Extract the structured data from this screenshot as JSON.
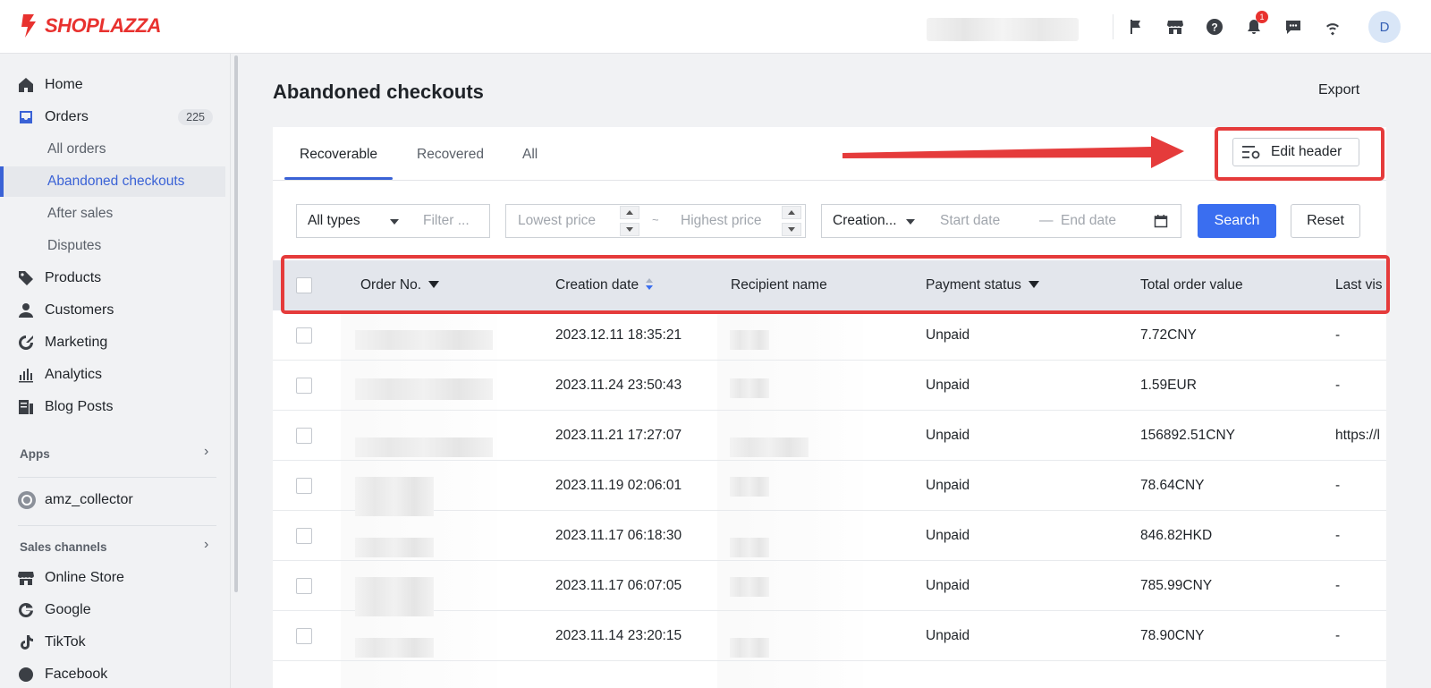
{
  "brand": {
    "name": "SHOPLAZZA",
    "color": "#e8322f",
    "accent": "#3a62d6"
  },
  "topbar": {
    "icons": [
      "flag-icon",
      "store-icon",
      "help-icon",
      "bell-icon",
      "chat-icon",
      "wifi-icon"
    ],
    "notification_count": "1",
    "avatar_initial": "D"
  },
  "sidebar": {
    "items": [
      {
        "label": "Home",
        "icon": "home-icon"
      },
      {
        "label": "Orders",
        "icon": "orders-icon",
        "badge": "225"
      },
      {
        "label": "All orders"
      },
      {
        "label": "Abandoned checkouts",
        "active": true
      },
      {
        "label": "After sales"
      },
      {
        "label": "Disputes"
      },
      {
        "label": "Products",
        "icon": "tag-icon"
      },
      {
        "label": "Customers",
        "icon": "person-icon"
      },
      {
        "label": "Marketing",
        "icon": "marketing-icon"
      },
      {
        "label": "Analytics",
        "icon": "bar-chart-icon"
      },
      {
        "label": "Blog Posts",
        "icon": "blog-icon"
      }
    ],
    "apps_label": "Apps",
    "app_item": "amz_collector",
    "sales_channels_label": "Sales channels",
    "channels": [
      {
        "label": "Online Store",
        "icon": "store-icon"
      },
      {
        "label": "Google",
        "icon": "google-icon"
      },
      {
        "label": "TikTok",
        "icon": "tiktok-icon"
      },
      {
        "label": "Facebook",
        "icon": "facebook-icon"
      }
    ]
  },
  "page": {
    "title": "Abandoned checkouts",
    "export_label": "Export"
  },
  "tabs": [
    {
      "label": "Recoverable",
      "active": true
    },
    {
      "label": "Recovered"
    },
    {
      "label": "All"
    }
  ],
  "edit_header_label": "Edit header",
  "filters": {
    "type_select": "All types",
    "filter_placeholder": "Filter ...",
    "lowest_price_placeholder": "Lowest price",
    "range_sep": "~",
    "highest_price_placeholder": "Highest price",
    "date_type_select": "Creation...",
    "start_date_placeholder": "Start date",
    "date_sep": "—",
    "end_date_placeholder": "End date",
    "search_label": "Search",
    "reset_label": "Reset"
  },
  "table": {
    "headers": {
      "order_no": "Order No.",
      "creation_date": "Creation date",
      "recipient": "Recipient name",
      "payment_status": "Payment status",
      "total": "Total order value",
      "last_visited": "Last vis"
    },
    "rows": [
      {
        "date": "2023.12.11 18:35:21",
        "status": "Unpaid",
        "total": "7.72CNY",
        "last": "-"
      },
      {
        "date": "2023.11.24 23:50:43",
        "status": "Unpaid",
        "total": "1.59EUR",
        "last": "-"
      },
      {
        "date": "2023.11.21 17:27:07",
        "status": "Unpaid",
        "total": "156892.51CNY",
        "last": "https://l"
      },
      {
        "date": "2023.11.19 02:06:01",
        "status": "Unpaid",
        "total": "78.64CNY",
        "last": "-"
      },
      {
        "date": "2023.11.17 06:18:30",
        "status": "Unpaid",
        "total": "846.82HKD",
        "last": "-"
      },
      {
        "date": "2023.11.17 06:07:05",
        "status": "Unpaid",
        "total": "785.99CNY",
        "last": "-"
      },
      {
        "date": "2023.11.14 23:20:15",
        "status": "Unpaid",
        "total": "78.90CNY",
        "last": "-"
      }
    ]
  }
}
